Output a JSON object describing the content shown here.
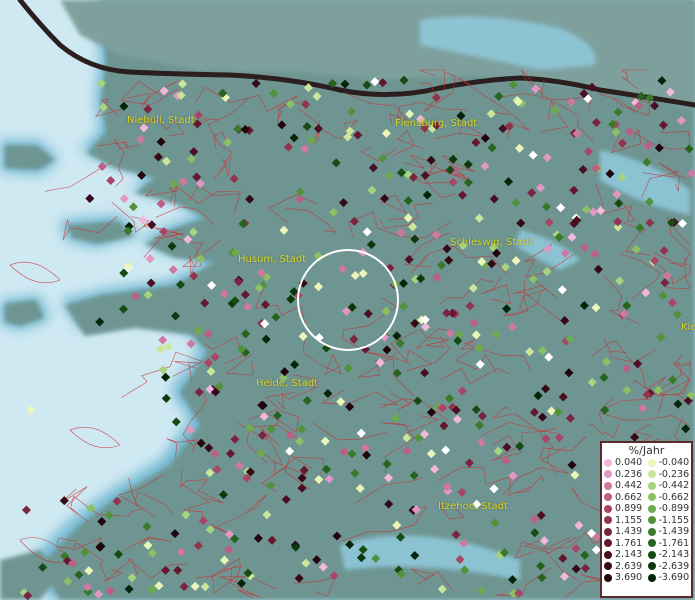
{
  "map": {
    "cities": [
      "Niebüll, Stadt",
      "Flensburg, Stadt",
      "Husum, Stadt",
      "Schleswig, Stadt",
      "Heide, Stadt",
      "Itzehoe, Stadt",
      "Kie"
    ]
  },
  "legend": {
    "title": "%/Jahr",
    "positive": [
      {
        "label": "0.040",
        "color": "#f2b8dc"
      },
      {
        "label": "0.236",
        "color": "#e297c2"
      },
      {
        "label": "0.442",
        "color": "#cf79a0"
      },
      {
        "label": "0.662",
        "color": "#bd5f84"
      },
      {
        "label": "0.899",
        "color": "#a94667"
      },
      {
        "label": "1.155",
        "color": "#93344f"
      },
      {
        "label": "1.439",
        "color": "#7b2440"
      },
      {
        "label": "1.761",
        "color": "#631830"
      },
      {
        "label": "2.143",
        "color": "#4b0e22"
      },
      {
        "label": "2.639",
        "color": "#360917"
      },
      {
        "label": "3.690",
        "color": "#22040c"
      }
    ],
    "negative": [
      {
        "label": "-0.040",
        "color": "#eaf5b8"
      },
      {
        "label": "-0.236",
        "color": "#c9e69a"
      },
      {
        "label": "-0.442",
        "color": "#a9d47e"
      },
      {
        "label": "-0.662",
        "color": "#8bc065"
      },
      {
        "label": "-0.899",
        "color": "#6eaa4e"
      },
      {
        "label": "-1.155",
        "color": "#52923a"
      },
      {
        "label": "-1.439",
        "color": "#3a7a2a"
      },
      {
        "label": "-1.761",
        "color": "#26631e"
      },
      {
        "label": "-2.143",
        "color": "#164c14"
      },
      {
        "label": "-2.639",
        "color": "#0b380d"
      },
      {
        "label": "-3.690",
        "color": "#042508"
      }
    ]
  },
  "colors": {
    "sea": "#cfe9f2",
    "land": "#6e9592",
    "coast_glow": "#54a8c8",
    "border": "#2a1e1e",
    "district_lines": "#c83232",
    "city_label": "#d8d422",
    "highlight_circle": "#ffffff"
  }
}
